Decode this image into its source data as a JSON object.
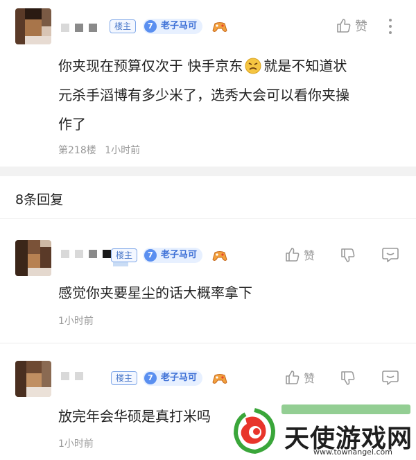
{
  "main_post": {
    "badge_owner": "楼主",
    "level_number": "7",
    "level_title": "老子马可",
    "like_label": "赞",
    "text_line1": "你夹现在预算仅次于 快手京东",
    "text_line1b": "就是不知道状",
    "text_line2": "元杀手滔博有多少米了，选秀大会可以看你夹操",
    "text_line3": "作了",
    "floor": "第218楼",
    "time": "1小时前"
  },
  "replies_header": {
    "count_label": "8条回复"
  },
  "replies": [
    {
      "badge_owner": "楼主",
      "level_number": "7",
      "level_title": "老子马可",
      "like_label": "赞",
      "text": "感觉你夹要星尘的话大概率拿下",
      "time": "1小时前"
    },
    {
      "badge_owner": "楼主",
      "level_number": "7",
      "level_title": "老子马可",
      "like_label": "赞",
      "text": "放完年会华硕是真打米",
      "text_tail": "吗",
      "time": "1小时前"
    }
  ],
  "watermark": {
    "site_name": "天使游戏网",
    "url": "www.townangel.com"
  },
  "colors": {
    "accent_blue": "#3c6fd6",
    "muted_gray": "#999999",
    "watermark_red": "#e8352b",
    "watermark_green": "#3aa63a"
  }
}
